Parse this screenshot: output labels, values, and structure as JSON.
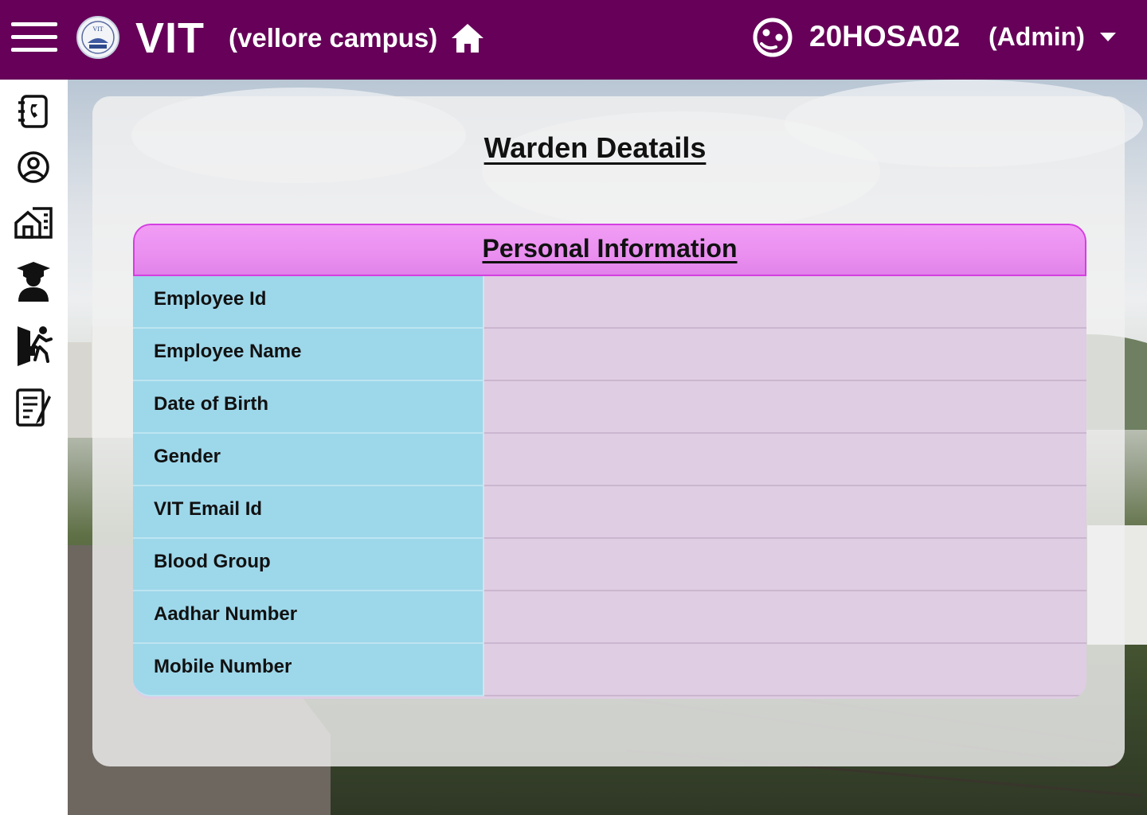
{
  "header": {
    "brand": "VIT",
    "campus": "(vellore campus)",
    "user_id": "20HOSA02",
    "role": "(Admin)",
    "logo_text": "VIT"
  },
  "sidebar": {
    "items": [
      {
        "name": "contacts-book-icon"
      },
      {
        "name": "profile-icon"
      },
      {
        "name": "hostel-building-icon"
      },
      {
        "name": "student-icon"
      },
      {
        "name": "leave-exit-icon"
      },
      {
        "name": "notes-edit-icon"
      }
    ]
  },
  "main": {
    "title": "Warden Deatails",
    "section_title": "Personal Information",
    "fields": [
      {
        "label": "Employee Id",
        "value": ""
      },
      {
        "label": "Employee Name",
        "value": ""
      },
      {
        "label": "Date of Birth",
        "value": ""
      },
      {
        "label": "Gender",
        "value": ""
      },
      {
        "label": "VIT Email Id",
        "value": ""
      },
      {
        "label": "Blood Group",
        "value": ""
      },
      {
        "label": "Aadhar Number",
        "value": ""
      },
      {
        "label": "Mobile Number",
        "value": ""
      }
    ]
  },
  "colors": {
    "header_bg": "#660058",
    "section_header": "#f19cf5",
    "label_bg": "#9dd7ea",
    "value_bg": "#dfcde3"
  }
}
